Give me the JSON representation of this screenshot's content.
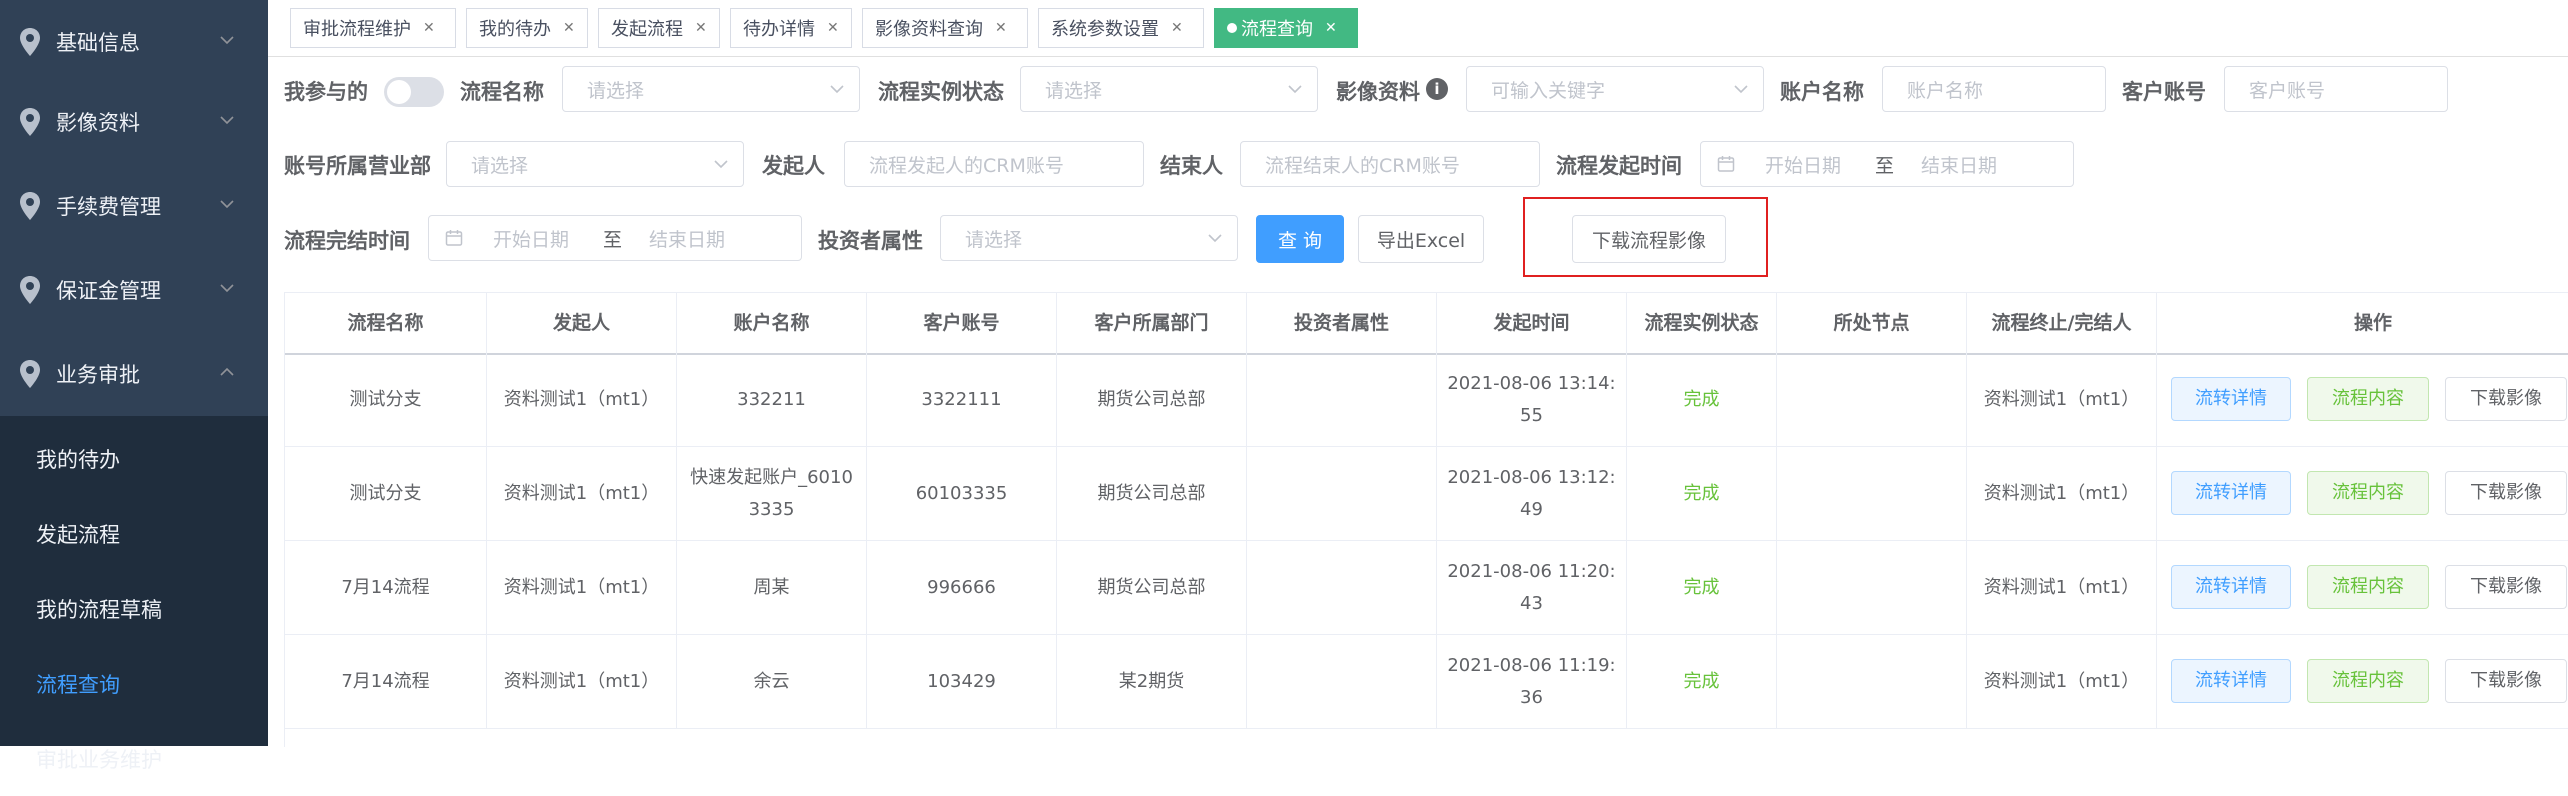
{
  "sidebar": {
    "menus": [
      {
        "label": "基础信息"
      },
      {
        "label": "影像资料"
      },
      {
        "label": "手续费管理"
      },
      {
        "label": "保证金管理"
      },
      {
        "label": "业务审批"
      }
    ],
    "submenu": [
      {
        "label": "我的待办"
      },
      {
        "label": "发起流程"
      },
      {
        "label": "我的流程草稿"
      },
      {
        "label": "流程查询"
      },
      {
        "label": "审批业务维护"
      }
    ]
  },
  "tabs": [
    {
      "label": "审批流程维护"
    },
    {
      "label": "我的待办"
    },
    {
      "label": "发起流程"
    },
    {
      "label": "待办详情"
    },
    {
      "label": "影像资料查询"
    },
    {
      "label": "系统参数设置"
    },
    {
      "label": "流程查询"
    }
  ],
  "filters": {
    "my_participated": "我参与的",
    "process_name": {
      "label": "流程名称",
      "placeholder": "请选择"
    },
    "instance_status": {
      "label": "流程实例状态",
      "placeholder": "请选择"
    },
    "image_data": {
      "label": "影像资料",
      "placeholder": "可输入关键字"
    },
    "account_name": {
      "label": "账户名称",
      "placeholder": "账户名称"
    },
    "customer_account": {
      "label": "客户账号",
      "placeholder": "客户账号"
    },
    "branch": {
      "label": "账号所属营业部",
      "placeholder": "请选择"
    },
    "initiator": {
      "label": "发起人",
      "placeholder": "流程发起人的CRM账号"
    },
    "closer": {
      "label": "结束人",
      "placeholder": "流程结束人的CRM账号"
    },
    "start_time": {
      "label": "流程发起时间",
      "start": "开始日期",
      "to": "至",
      "end": "结束日期"
    },
    "finish_time": {
      "label": "流程完结时间",
      "start": "开始日期",
      "to": "至",
      "end": "结束日期"
    },
    "investor_attr": {
      "label": "投资者属性",
      "placeholder": "请选择"
    },
    "query_button": "查 询",
    "export_button": "导出Excel",
    "download_button": "下载流程影像"
  },
  "table": {
    "headers": [
      "流程名称",
      "发起人",
      "账户名称",
      "客户账号",
      "客户所属部门",
      "投资者属性",
      "发起时间",
      "流程实例状态",
      "所处节点",
      "流程终止/完结人",
      "操作"
    ],
    "rows": [
      [
        "测试分支",
        "资料测试1（mt1）",
        "332211",
        "3322111",
        "期货公司总部",
        "",
        "2021-08-06 13:14:55",
        "完成",
        "",
        "资料测试1（mt1）"
      ],
      [
        "测试分支",
        "资料测试1（mt1）",
        "快速发起账户_60103335",
        "60103335",
        "期货公司总部",
        "",
        "2021-08-06 13:12:49",
        "完成",
        "",
        "资料测试1（mt1）"
      ],
      [
        "7月14流程",
        "资料测试1（mt1）",
        "周某",
        "996666",
        "期货公司总部",
        "",
        "2021-08-06 11:20:43",
        "完成",
        "",
        "资料测试1（mt1）"
      ],
      [
        "7月14流程",
        "资料测试1（mt1）",
        "余云",
        "103429",
        "某2期货",
        "",
        "2021-08-06 11:19:36",
        "完成",
        "",
        "资料测试1（mt1）"
      ]
    ],
    "actions": [
      "流转详情",
      "流程内容",
      "下载影像"
    ]
  },
  "colors": {
    "sidebar": "#304156",
    "submenu": "#1f2d3d",
    "active_tab": "#42b983",
    "primary": "#409eff",
    "success": "#67c23a",
    "highlight": "#e02020"
  }
}
